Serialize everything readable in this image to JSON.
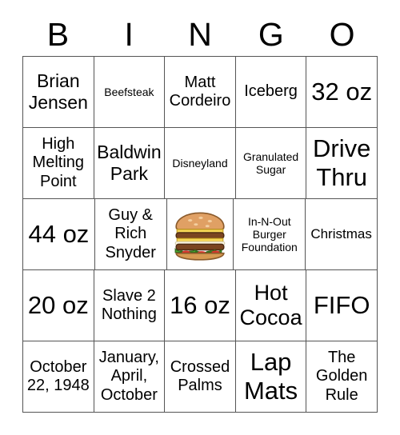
{
  "card": {
    "header": {
      "letters": [
        "B",
        "I",
        "N",
        "G",
        "O"
      ]
    },
    "rows": [
      [
        {
          "text": "Brian Jensen",
          "size": "lg"
        },
        {
          "text": "Beefsteak",
          "size": "xs"
        },
        {
          "text": "Matt Cordeiro",
          "size": "md"
        },
        {
          "text": "Iceberg",
          "size": "md"
        },
        {
          "text": "32 oz",
          "size": "xxl"
        }
      ],
      [
        {
          "text": "High Melting Point",
          "size": "md"
        },
        {
          "text": "Baldwin Park",
          "size": "lg"
        },
        {
          "text": "Disneyland",
          "size": "xs"
        },
        {
          "text": "Granulated Sugar",
          "size": "xs"
        },
        {
          "text": "Drive Thru",
          "size": "xxl"
        }
      ],
      [
        {
          "text": "44 oz",
          "size": "xxl"
        },
        {
          "text": "Guy & Rich Snyder",
          "size": "md"
        },
        {
          "icon": "hamburger-image"
        },
        {
          "text": "In-N-Out Burger Foundation",
          "size": "xs"
        },
        {
          "text": "Christmas",
          "size": "sm"
        }
      ],
      [
        {
          "text": "20 oz",
          "size": "xxl"
        },
        {
          "text": "Slave 2 Nothing",
          "size": "md"
        },
        {
          "text": "16 oz",
          "size": "xxl"
        },
        {
          "text": "Hot Cocoa",
          "size": "xl"
        },
        {
          "text": "FIFO",
          "size": "xxl"
        }
      ],
      [
        {
          "text": "October 22, 1948",
          "size": "md"
        },
        {
          "text": "January, April, October",
          "size": "md"
        },
        {
          "text": "Crossed Palms",
          "size": "md"
        },
        {
          "text": "Lap Mats",
          "size": "xxl"
        },
        {
          "text": "The Golden Rule",
          "size": "md"
        }
      ]
    ]
  },
  "colors": {
    "grid_line": "#555555",
    "text": "#000000",
    "background": "#ffffff"
  }
}
